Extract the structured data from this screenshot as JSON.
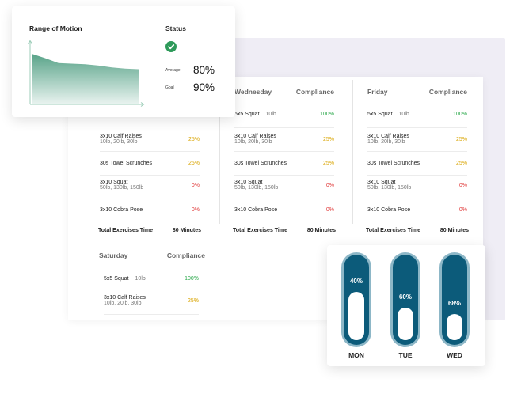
{
  "range_of_motion": {
    "title": "Range of Motion",
    "chart_data": {
      "type": "area",
      "title": "Range of Motion",
      "xlabel": "",
      "ylabel": "",
      "x": [
        0,
        1,
        2,
        3,
        4,
        5,
        6,
        7,
        8
      ],
      "values": [
        0.82,
        0.75,
        0.67,
        0.66,
        0.65,
        0.63,
        0.6,
        0.58,
        0.57
      ],
      "ylim": [
        0,
        1
      ],
      "fill_color": "#4f9e82",
      "grid": false
    }
  },
  "status": {
    "title": "Status",
    "icon": "check-circle-icon",
    "icon_color": "#2e9a5a",
    "average_label": "Average",
    "average_value": "80%",
    "goal_label": "Goal",
    "goal_value": "90%"
  },
  "schedule": {
    "compliance_label": "Compliance",
    "total_label": "Total Exercises Time",
    "monday": {
      "rows": [
        {
          "name": "3x10 Calf Raises",
          "weight": "10lb, 20lb, 30lb",
          "pct": "25%",
          "level": "yellow"
        },
        {
          "name": "30s Towel Scrunches",
          "weight": "",
          "pct": "25%",
          "level": "yellow"
        },
        {
          "name": "3x10 Squat",
          "weight": "50lb, 130lb, 150lb",
          "pct": "0%",
          "level": "red"
        },
        {
          "name": "3x10 Cobra Pose",
          "weight": "",
          "pct": "0%",
          "level": "red"
        }
      ],
      "total": "80 Minutes"
    },
    "wednesday": {
      "day": "Wednesday",
      "rows": [
        {
          "name": "5x5 Squat",
          "weight": "10lb",
          "pct": "100%",
          "level": "green"
        },
        {
          "name": "3x10 Calf Raises",
          "weight": "10lb, 20lb, 30lb",
          "pct": "25%",
          "level": "yellow"
        },
        {
          "name": "30s Towel Scrunches",
          "weight": "",
          "pct": "25%",
          "level": "yellow"
        },
        {
          "name": "3x10 Squat",
          "weight": "50lb, 130lb, 150lb",
          "pct": "0%",
          "level": "red"
        },
        {
          "name": "3x10 Cobra Pose",
          "weight": "",
          "pct": "0%",
          "level": "red"
        }
      ],
      "total": "80 Minutes"
    },
    "friday": {
      "day": "Friday",
      "rows": [
        {
          "name": "5x5 Squat",
          "weight": "10lb",
          "pct": "100%",
          "level": "green"
        },
        {
          "name": "3x10 Calf Raises",
          "weight": "10lb, 20lb, 30lb",
          "pct": "25%",
          "level": "yellow"
        },
        {
          "name": "30s Towel Scrunches",
          "weight": "",
          "pct": "25%",
          "level": "yellow"
        },
        {
          "name": "3x10 Squat",
          "weight": "50lb, 130lb, 150lb",
          "pct": "0%",
          "level": "red"
        },
        {
          "name": "3x10 Cobra Pose",
          "weight": "",
          "pct": "0%",
          "level": "red"
        }
      ],
      "total": "80 Minutes"
    },
    "saturday": {
      "day": "Saturday",
      "rows": [
        {
          "name": "5x5 Squat",
          "weight": "10lb",
          "pct": "100%",
          "level": "green"
        },
        {
          "name": "3x10 Calf Raises",
          "weight": "10lb, 20lb, 30lb",
          "pct": "25%",
          "level": "yellow"
        }
      ]
    }
  },
  "progress": {
    "colors": {
      "outer": "#8db7c7",
      "inner": "#0c5b7a",
      "fill": "#ffffff"
    },
    "items": [
      {
        "day": "MON",
        "label": "40%",
        "value": 0.4
      },
      {
        "day": "TUE",
        "label": "60%",
        "value": 0.6
      },
      {
        "day": "WED",
        "label": "68%",
        "value": 0.68
      }
    ]
  }
}
